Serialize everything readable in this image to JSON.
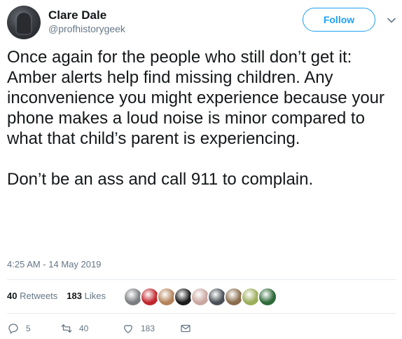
{
  "author": {
    "name": "Clare Dale",
    "handle": "@profhistorygeek"
  },
  "header": {
    "follow_label": "Follow"
  },
  "tweet": {
    "text": "Once again for the people who still don’t get it:\nAmber alerts help find missing children. Any inconvenience you might experience because your phone makes a loud noise is minor compared to what that child’s parent is experiencing.\n\nDon’t be an ass and call 911 to complain.",
    "timestamp": "4:25 AM - 14 May 2019"
  },
  "stats": {
    "retweets_count": "40",
    "retweets_label": "Retweets",
    "likes_count": "183",
    "likes_label": "Likes"
  },
  "likers": [
    {
      "icon": "avatar-1",
      "color": "#7a7d80"
    },
    {
      "icon": "avatar-2",
      "color": "#c0272d"
    },
    {
      "icon": "avatar-3",
      "color": "#b5835a"
    },
    {
      "icon": "avatar-4",
      "color": "#1b1b1b"
    },
    {
      "icon": "avatar-5",
      "color": "#c9a7a0"
    },
    {
      "icon": "avatar-6",
      "color": "#4a4f57"
    },
    {
      "icon": "avatar-7",
      "color": "#8a6d4d"
    },
    {
      "icon": "avatar-8",
      "color": "#9bae5a"
    },
    {
      "icon": "avatar-9",
      "color": "#2f6b3a"
    }
  ],
  "actions": {
    "reply_count": "5",
    "retweet_count": "40",
    "like_count": "183"
  },
  "colors": {
    "accent": "#1da1f2",
    "text_primary": "#14171a",
    "text_secondary": "#657786",
    "divider": "#e6ecf0"
  }
}
